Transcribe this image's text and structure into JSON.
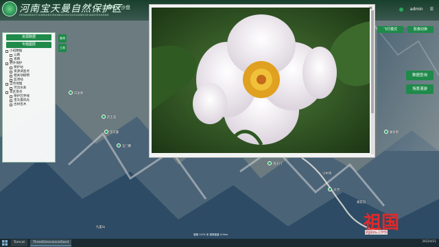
{
  "header": {
    "title": "河南宝天曼自然保护区",
    "subtitle": "三维电子沙盘",
    "pinyin": "HENANBAOTIANMANZIRANBAOHUQUSANWEIDIANZISHAPAN",
    "user": "admin"
  },
  "left_panel": {
    "button_top": "资源数据",
    "button_second": "专题图层",
    "tree": [
      "小班数据",
      "公路",
      "道路",
      "野外保护",
      "保护站",
      "资源调查点",
      "相关动植物",
      "监测站",
      "自然地理",
      "河流水系",
      "景区景点",
      "保护区界线",
      "宝天曼风光",
      "古树名木"
    ]
  },
  "side_tools": [
    "查询",
    "工具"
  ],
  "popup": {
    "close": "×"
  },
  "right_buttons": [
    "飞行模式",
    "影像切换",
    "数据查询",
    "场景漫游"
  ],
  "map_labels": [
    "白鼠窝",
    "药王庙",
    "宝天曼",
    "石门寨",
    "南天门",
    "小中湾",
    "天河",
    "黄花沟",
    "葛条爬",
    "九里山"
  ],
  "taskbar": {
    "items": [
      "Tomcat",
      "ThreeDimensionalSand"
    ],
    "clock": "2022/4/21"
  },
  "scale": "高程 1474 米  视角高度 4.5km",
  "watermark": {
    "cn": "祖国",
    "url": "zgzzs.com"
  }
}
